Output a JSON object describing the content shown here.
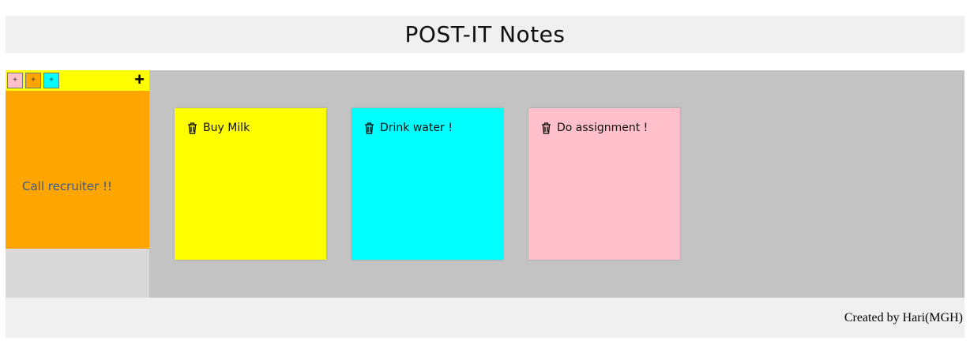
{
  "header": {
    "title": "POST-IT Notes"
  },
  "sidebar": {
    "color_buttons": [
      {
        "label": "+",
        "color": "#ffc0cb",
        "icon": "plus-icon"
      },
      {
        "label": "+",
        "color": "#ffa500",
        "icon": "plus-icon"
      },
      {
        "label": "+",
        "color": "#00ffff",
        "icon": "plus-icon"
      }
    ],
    "add_label": "+",
    "toolbar_color": "#ffff00",
    "draft_note": {
      "text": "Call recruiter !!",
      "color": "#ffa500"
    }
  },
  "board": {
    "notes": [
      {
        "text": "Buy Milk",
        "color": "#ffff00",
        "icon": "trash-icon"
      },
      {
        "text": "Drink water !",
        "color": "#00ffff",
        "icon": "trash-icon"
      },
      {
        "text": "Do assignment !",
        "color": "#ffc0cb",
        "icon": "trash-icon"
      }
    ]
  },
  "footer": {
    "credit": "Created by Hari(MGH)"
  }
}
